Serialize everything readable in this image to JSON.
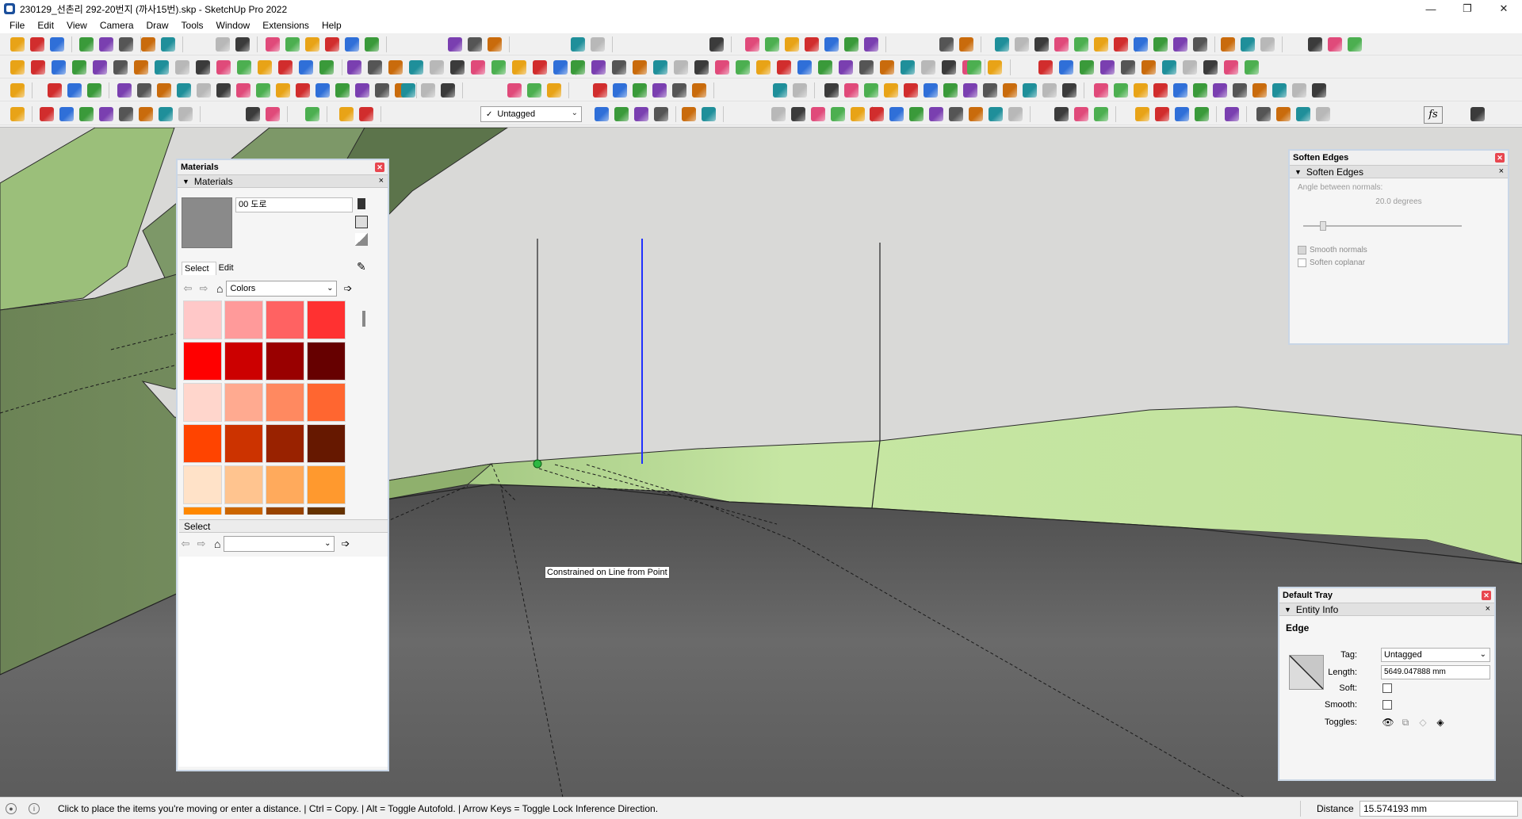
{
  "window": {
    "title": "230129_선촌리 292-20번지 (까사15번).skp - SketchUp Pro 2022",
    "min": "—",
    "max": "❐",
    "close": "✕"
  },
  "menu": [
    "File",
    "Edit",
    "View",
    "Camera",
    "Draw",
    "Tools",
    "Window",
    "Extensions",
    "Help"
  ],
  "toolbar": {
    "tag_dropdown": "Untagged",
    "fs_label": "fs"
  },
  "viewport": {
    "inference_tip": "Constrained on Line from Point",
    "colors": {
      "sky": "#d9d9d7",
      "terrain_dark": "#6f855a",
      "terrain_light": "#bfe19b",
      "road": "#5b5b5b",
      "axis_blue": "#2030ff"
    }
  },
  "materials_panel": {
    "title": "Materials",
    "section": "Materials",
    "material_name": "00 도로",
    "tab_select": "Select",
    "tab_edit": "Edit",
    "library": "Colors",
    "select_section": "Select",
    "select_combo": "",
    "swatches": [
      "#ffc8c8",
      "#ff9a9a",
      "#ff6262",
      "#ff3131",
      "#ff0000",
      "#cc0000",
      "#990000",
      "#660000",
      "#ffd6cc",
      "#ffaa90",
      "#ff8960",
      "#ff6630",
      "#ff4400",
      "#cc3300",
      "#992200",
      "#661800",
      "#ffe2c8",
      "#ffc48f",
      "#ffaa5c",
      "#ff992e",
      "#ff8800",
      "#cc6600",
      "#994400",
      "#663300"
    ]
  },
  "soften_edges": {
    "title": "Soften Edges",
    "section": "Soften Edges",
    "angle_label": "Angle between normals:",
    "angle_value": "20.0  degrees",
    "angle_degrees": 20.0,
    "smooth_normals": "Smooth normals",
    "soften_coplanar": "Soften coplanar",
    "smooth_normals_checked": true,
    "soften_coplanar_checked": false
  },
  "default_tray": {
    "title": "Default Tray",
    "section": "Entity Info",
    "entity_type": "Edge",
    "tag_label": "Tag:",
    "tag_value": "Untagged",
    "length_label": "Length:",
    "length_value": "5649.047888 mm",
    "soft_label": "Soft:",
    "smooth_label": "Smooth:",
    "toggles_label": "Toggles:",
    "soft_checked": false,
    "smooth_checked": false
  },
  "statusbar": {
    "hint": "Click to place the items you're moving or enter a distance. | Ctrl = Copy. | Alt = Toggle Autofold. | Arrow Keys = Toggle Lock Inference Direction.",
    "measure_label": "Distance",
    "measure_value": "15.574193 mm"
  }
}
